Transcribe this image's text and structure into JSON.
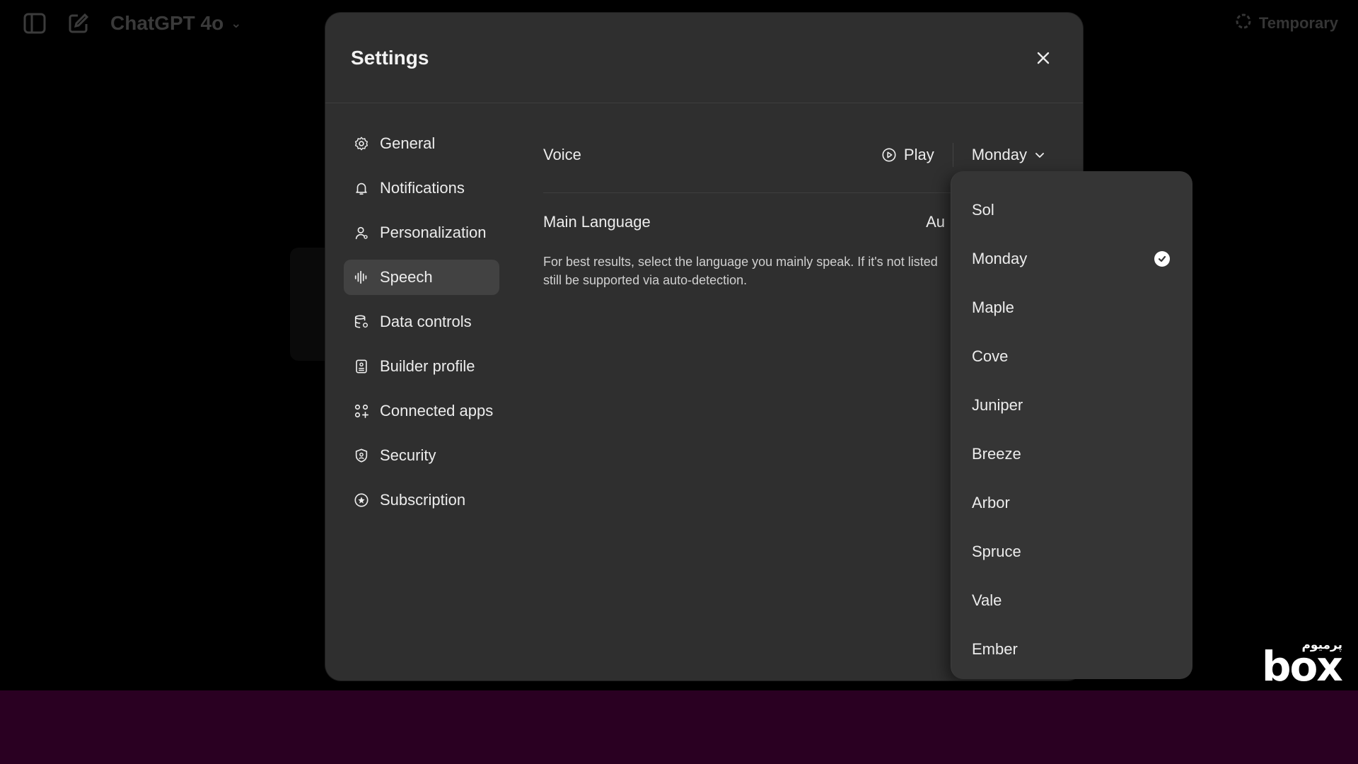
{
  "app": {
    "model_name": "ChatGPT 4o",
    "temporary_label": "Temporary"
  },
  "modal": {
    "title": "Settings"
  },
  "sidebar": {
    "items": [
      {
        "label": "General",
        "icon": "gear-icon"
      },
      {
        "label": "Notifications",
        "icon": "bell-icon"
      },
      {
        "label": "Personalization",
        "icon": "person-icon"
      },
      {
        "label": "Speech",
        "icon": "waveform-icon",
        "active": true
      },
      {
        "label": "Data controls",
        "icon": "database-icon"
      },
      {
        "label": "Builder profile",
        "icon": "id-card-icon"
      },
      {
        "label": "Connected apps",
        "icon": "apps-grid-icon"
      },
      {
        "label": "Security",
        "icon": "shield-icon"
      },
      {
        "label": "Subscription",
        "icon": "badge-icon"
      }
    ]
  },
  "speech": {
    "voice_label": "Voice",
    "play_label": "Play",
    "selected_voice": "Monday",
    "language_label": "Main Language",
    "language_value": "Au",
    "language_description": "For best results, select the language you mainly speak. If it's not listed still be supported via auto-detection."
  },
  "voice_dropdown": {
    "options": [
      "Sol",
      "Monday",
      "Maple",
      "Cove",
      "Juniper",
      "Breeze",
      "Arbor",
      "Spruce",
      "Vale",
      "Ember"
    ],
    "selected": "Monday"
  },
  "watermark": {
    "small_text": "پرمیوم",
    "big_text": "box"
  },
  "colors": {
    "modal_bg": "#2f2f2f",
    "dropdown_bg": "#353535",
    "active_nav_bg": "#424242",
    "bottom_band": "#2a0022"
  }
}
